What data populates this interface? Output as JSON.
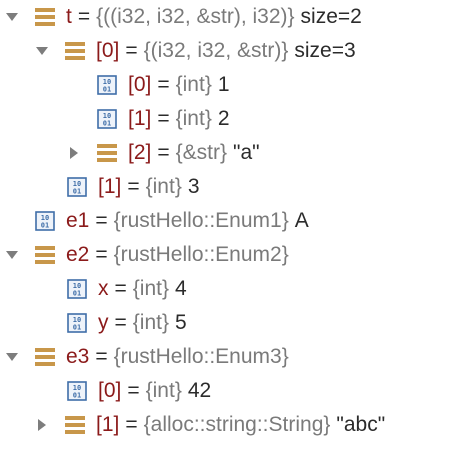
{
  "colors": {
    "name": "#8b1a1a",
    "type": "#7a7a7a",
    "value": "#2b2b2b",
    "struct_icon": "#c8974a",
    "prim_icon_border": "#3f6ea8",
    "toggle": "#7d7d7d"
  },
  "variables": [
    {
      "toggle": "expanded",
      "icon": "struct-icon",
      "name": "t",
      "eq": "=",
      "type": "{((i32, i32, &str), i32)}",
      "value": "size=2"
    },
    {
      "toggle": "expanded",
      "icon": "struct-icon",
      "name": "[0]",
      "eq": "=",
      "type": "{(i32, i32, &str)}",
      "value": "size=3"
    },
    {
      "toggle": "none",
      "icon": "primitive-icon",
      "name": "[0]",
      "eq": "=",
      "type": "{int}",
      "value": "1"
    },
    {
      "toggle": "none",
      "icon": "primitive-icon",
      "name": "[1]",
      "eq": "=",
      "type": "{int}",
      "value": "2"
    },
    {
      "toggle": "collapsed",
      "icon": "struct-icon",
      "name": "[2]",
      "eq": "=",
      "type": "{&str}",
      "value": "\"a\""
    },
    {
      "toggle": "none",
      "icon": "primitive-icon",
      "name": "[1]",
      "eq": "=",
      "type": "{int}",
      "value": "3"
    },
    {
      "toggle": "none",
      "icon": "primitive-icon",
      "name": "e1",
      "eq": "=",
      "type": "{rustHello::Enum1}",
      "value": "A"
    },
    {
      "toggle": "expanded",
      "icon": "struct-icon",
      "name": "e2",
      "eq": "=",
      "type": "{rustHello::Enum2}",
      "value": ""
    },
    {
      "toggle": "none",
      "icon": "primitive-icon",
      "name": "x",
      "eq": "=",
      "type": "{int}",
      "value": "4"
    },
    {
      "toggle": "none",
      "icon": "primitive-icon",
      "name": "y",
      "eq": "=",
      "type": "{int}",
      "value": "5"
    },
    {
      "toggle": "expanded",
      "icon": "struct-icon",
      "name": "e3",
      "eq": "=",
      "type": "{rustHello::Enum3}",
      "value": ""
    },
    {
      "toggle": "none",
      "icon": "primitive-icon",
      "name": "[0]",
      "eq": "=",
      "type": "{int}",
      "value": "42"
    },
    {
      "toggle": "collapsed",
      "icon": "struct-icon",
      "name": "[1]",
      "eq": "=",
      "type": "{alloc::string::String}",
      "value": "\"abc\""
    }
  ]
}
